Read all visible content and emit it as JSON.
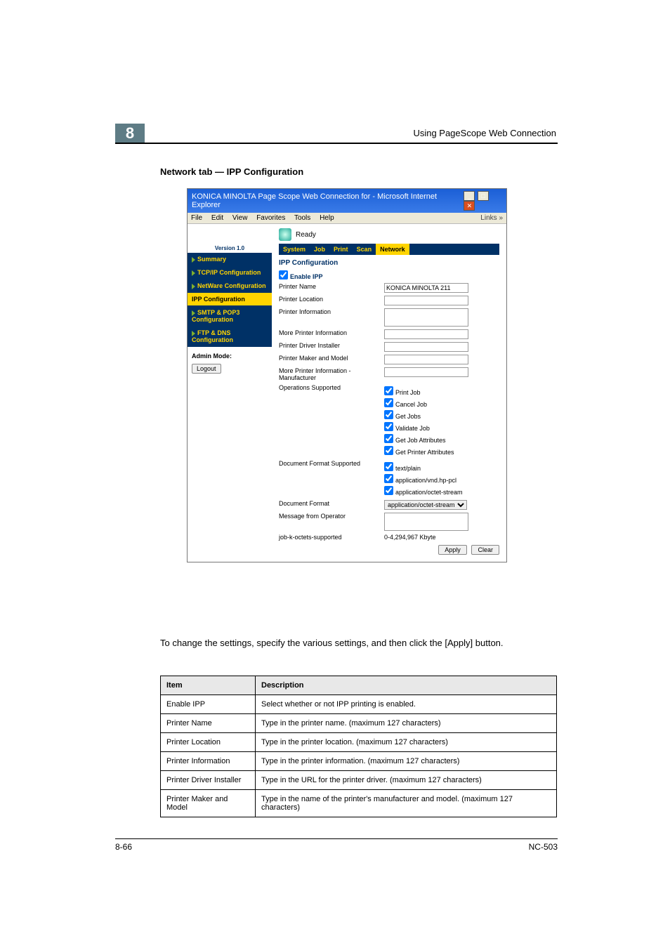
{
  "header": {
    "chapter_number": "8",
    "running_head": "Using PageScope Web Connection",
    "section_title": "Network tab — IPP Configuration"
  },
  "screenshot": {
    "window_title": "KONICA MINOLTA Page Scope Web Connection for       - Microsoft Internet Explorer",
    "ie_menu": {
      "file": "File",
      "edit": "Edit",
      "view": "View",
      "favorites": "Favorites",
      "tools": "Tools",
      "help": "Help",
      "links": "Links"
    },
    "status_text": "Ready",
    "version_label": "Version 1.0",
    "tabs": {
      "system": "System",
      "job": "Job",
      "print": "Print",
      "scan": "Scan",
      "network": "Network"
    },
    "nav": {
      "summary": "Summary",
      "tcpip": "TCP/IP Configuration",
      "netware": "NetWare Configuration",
      "ipp": "IPP Configuration",
      "smtp": "SMTP & POP3 Configuration",
      "ftpdns": "FTP & DNS Configuration"
    },
    "admin": {
      "mode_label": "Admin Mode:",
      "logout": "Logout"
    },
    "form": {
      "title": "IPP Configuration",
      "enable_ipp": "Enable IPP",
      "printer_name": "Printer Name",
      "printer_name_value": "KONICA MINOLTA 211",
      "printer_location": "Printer Location",
      "printer_information": "Printer Information",
      "more_printer_information": "More Printer Information",
      "printer_driver_installer": "Printer Driver Installer",
      "printer_maker_model": "Printer Maker and Model",
      "more_printer_info_manuf": "More Printer Information - Manufacturer",
      "operations_supported": "Operations Supported",
      "op_print_job": "Print Job",
      "op_cancel_job": "Cancel Job",
      "op_get_jobs": "Get Jobs",
      "op_validate_job": "Validate Job",
      "op_get_job_attr": "Get Job Attributes",
      "op_get_printer_attr": "Get Printer Attributes",
      "document_format_supported": "Document Format Supported",
      "df_text_plain": "text/plain",
      "df_vnd_hp_pcl": "application/vnd.hp-pcl",
      "df_octet_stream": "application/octet-stream",
      "document_format": "Document Format",
      "document_format_value": "application/octet-stream",
      "message_from_operator": "Message from Operator",
      "job_k_octets_supported": "job-k-octets-supported",
      "job_k_octets_value": "0-4,294,967 Kbyte",
      "apply": "Apply",
      "clear": "Clear"
    }
  },
  "intro_text": "To change the settings, specify the various settings, and then click the [Apply] button.",
  "table": {
    "head_item": "Item",
    "head_description": "Description",
    "rows": [
      {
        "item": "Enable IPP",
        "desc": "Select whether or not IPP printing is enabled."
      },
      {
        "item": "Printer Name",
        "desc": "Type in the printer name. (maximum 127 characters)"
      },
      {
        "item": "Printer Location",
        "desc": "Type in the printer location. (maximum 127 characters)"
      },
      {
        "item": "Printer Information",
        "desc": "Type in the printer information. (maximum 127 characters)"
      },
      {
        "item": "Printer Driver Installer",
        "desc": "Type in the URL for the printer driver. (maximum 127 characters)"
      },
      {
        "item": "Printer Maker and Model",
        "desc": "Type in the name of the printer's manufacturer and model. (maximum 127 characters)"
      }
    ]
  },
  "footer": {
    "page": "8-66",
    "model": "NC-503"
  }
}
